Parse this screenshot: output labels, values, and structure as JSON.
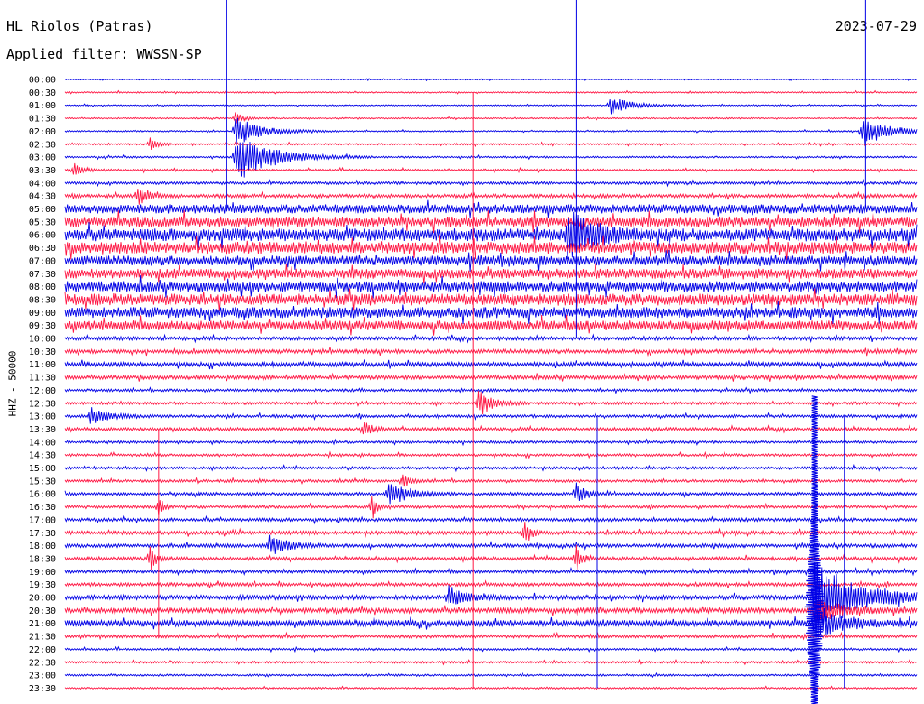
{
  "header": {
    "station": "HL Riolos (Patras)",
    "filter": "Applied filter: WWSSN-SP",
    "date": "2023-07-29"
  },
  "chart_data": {
    "type": "line",
    "title": "HL Riolos (Patras)",
    "subtitle": "Applied filter: WWSSN-SP",
    "date": "2023-07-29",
    "ylabel": "HHZ - 50000",
    "xlabel": "",
    "row_labels": [
      "00:00",
      "00:30",
      "01:00",
      "01:30",
      "02:00",
      "02:30",
      "03:00",
      "03:30",
      "04:00",
      "04:30",
      "05:00",
      "05:30",
      "06:00",
      "06:30",
      "07:00",
      "07:30",
      "08:00",
      "08:30",
      "09:00",
      "09:30",
      "10:00",
      "10:30",
      "11:00",
      "11:30",
      "12:00",
      "12:30",
      "13:00",
      "13:30",
      "14:00",
      "14:30",
      "15:00",
      "15:30",
      "16:00",
      "16:30",
      "17:00",
      "17:30",
      "18:00",
      "18:30",
      "19:00",
      "19:30",
      "20:00",
      "20:30",
      "21:00",
      "21:30",
      "22:00",
      "22:30",
      "23:00",
      "23:30"
    ],
    "row_colors": [
      "#0000e6",
      "#ff1744"
    ],
    "row_noise": [
      0.6,
      0.8,
      0.7,
      0.8,
      0.8,
      1.0,
      1.0,
      1.2,
      1.5,
      2.0,
      5.0,
      6.0,
      7.0,
      6.5,
      5.5,
      5.5,
      6.0,
      6.5,
      6.0,
      5.5,
      2.0,
      2.2,
      2.5,
      2.2,
      1.5,
      1.5,
      1.6,
      1.8,
      1.4,
      1.4,
      1.5,
      1.5,
      1.7,
      1.6,
      1.8,
      2.0,
      2.0,
      1.9,
      1.8,
      1.9,
      2.5,
      2.8,
      3.5,
      1.8,
      1.2,
      1.2,
      1.1,
      1.0
    ],
    "events": [
      {
        "row": 2,
        "x": 0.64,
        "amp": 10,
        "dur": 0.025
      },
      {
        "row": 3,
        "x": 0.2,
        "amp": 6,
        "dur": 0.01
      },
      {
        "row": 4,
        "x": 0.2,
        "amp": 16,
        "dur": 0.03
      },
      {
        "row": 4,
        "x": 0.935,
        "amp": 18,
        "dur": 0.03
      },
      {
        "row": 5,
        "x": 0.1,
        "amp": 8,
        "dur": 0.008
      },
      {
        "row": 6,
        "x": 0.2,
        "amp": 28,
        "dur": 0.04
      },
      {
        "row": 7,
        "x": 0.01,
        "amp": 8,
        "dur": 0.01
      },
      {
        "row": 9,
        "x": 0.085,
        "amp": 12,
        "dur": 0.01
      },
      {
        "row": 12,
        "x": 0.59,
        "amp": 25,
        "dur": 0.03
      },
      {
        "row": 25,
        "x": 0.485,
        "amp": 18,
        "dur": 0.015
      },
      {
        "row": 26,
        "x": 0.03,
        "amp": 10,
        "dur": 0.02
      },
      {
        "row": 27,
        "x": 0.35,
        "amp": 8,
        "dur": 0.01
      },
      {
        "row": 31,
        "x": 0.395,
        "amp": 10,
        "dur": 0.008
      },
      {
        "row": 32,
        "x": 0.38,
        "amp": 15,
        "dur": 0.02
      },
      {
        "row": 32,
        "x": 0.6,
        "amp": 12,
        "dur": 0.01
      },
      {
        "row": 33,
        "x": 0.11,
        "amp": 14,
        "dur": 0.005
      },
      {
        "row": 33,
        "x": 0.36,
        "amp": 16,
        "dur": 0.005
      },
      {
        "row": 35,
        "x": 0.54,
        "amp": 16,
        "dur": 0.006
      },
      {
        "row": 36,
        "x": 0.24,
        "amp": 12,
        "dur": 0.02
      },
      {
        "row": 37,
        "x": 0.1,
        "amp": 16,
        "dur": 0.006
      },
      {
        "row": 37,
        "x": 0.6,
        "amp": 16,
        "dur": 0.006
      },
      {
        "row": 40,
        "x": 0.45,
        "amp": 12,
        "dur": 0.02
      },
      {
        "row": 40,
        "x": 0.88,
        "amp": 40,
        "dur": 0.05
      },
      {
        "row": 41,
        "x": 0.88,
        "amp": 14,
        "dur": 0.03
      },
      {
        "row": 42,
        "x": 0.88,
        "amp": 18,
        "dur": 0.03
      }
    ],
    "spikes": [
      {
        "x": 0.6,
        "row_from": 0,
        "row_to": 20
      },
      {
        "x": 0.479,
        "row_from": 1,
        "row_to": 47
      },
      {
        "x": 0.94,
        "row_from": 0,
        "row_to": 10
      },
      {
        "x": 0.19,
        "row_from": 0,
        "row_to": 10
      },
      {
        "x": 0.915,
        "row_from": 26,
        "row_to": 47
      },
      {
        "x": 0.11,
        "row_from": 27,
        "row_to": 43
      },
      {
        "x": 0.625,
        "row_from": 26,
        "row_to": 47
      }
    ],
    "big_event": {
      "x": 0.88,
      "row_from": 25,
      "row_to": 47
    }
  }
}
